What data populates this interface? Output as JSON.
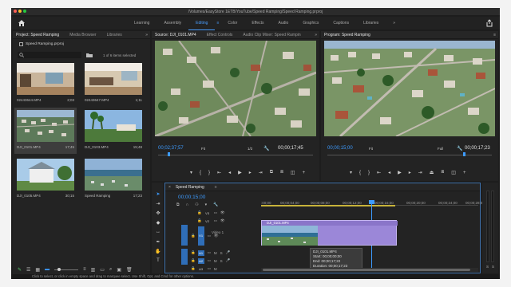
{
  "window": {
    "title": "/Volumes/EasyStore 1ETB/YouTube/Speed Ramping/Speed Ramping.prproj"
  },
  "workspaces": [
    "Learning",
    "Assembly",
    "Editing",
    "Color",
    "Effects",
    "Audio",
    "Graphics",
    "Captions",
    "Libraries"
  ],
  "active_workspace": "Editing",
  "project_panel": {
    "tabs": [
      "Project: Speed Ramping",
      "Media Browser",
      "Libraries"
    ],
    "file_name": "Speed Ramping.prproj",
    "selection_info": "1 of 6 items selected",
    "items": [
      {
        "name": "02443644.MP4",
        "duration": "2;03"
      },
      {
        "name": "02443647.MP4",
        "duration": "1;11"
      },
      {
        "name": "DJI_0101.MP4",
        "duration": "17;45"
      },
      {
        "name": "DJI_0103.MP4",
        "duration": "15;48"
      },
      {
        "name": "DJI_0105.MP4",
        "duration": "30;15"
      },
      {
        "name": "Speed Ramping",
        "duration": "17;23"
      }
    ]
  },
  "source_panel": {
    "tabs": [
      "Source: DJI_0101.MP4",
      "Effect Controls",
      "Audio Clip Mixer: Speed Rampin"
    ],
    "timecode": "00;02;37;57",
    "fit": "Fit",
    "resolution": "1/2",
    "duration": "00;00;17;45"
  },
  "program_panel": {
    "tabs": [
      "Program: Speed Ramping"
    ],
    "timecode": "00;00;15;00",
    "fit": "Fit",
    "resolution": "Full",
    "duration": "00;00;17;23"
  },
  "timeline": {
    "tab": "Speed Ramping",
    "timecode": "00;00;15;00",
    "ruler_labels": [
      ":00;00",
      "00;00;04;00",
      "00;00;08;00",
      "00;00;12;00",
      "00;00;16;00",
      "00;00;20;00",
      "00;00;24;00",
      "00;00;28;00"
    ],
    "video_tracks": [
      "V3",
      "V2",
      "V1"
    ],
    "audio_tracks": [
      "A1",
      "A2",
      "A3"
    ],
    "track_name": "Video 1",
    "clip_label": "DJI_0101.MP4",
    "tooltip": {
      "name": "DJI_0101.MP4",
      "start": "Start: 00;00;00;00",
      "end": "End: 00;00;17;22",
      "duration": "Duration: 00;00;17;23"
    }
  },
  "meters": {
    "labels": [
      "S",
      "S"
    ]
  },
  "status_text": "Click to select, or click in empty space and drag to marquee select. Use Shift, Opt, and Cmd for other options."
}
